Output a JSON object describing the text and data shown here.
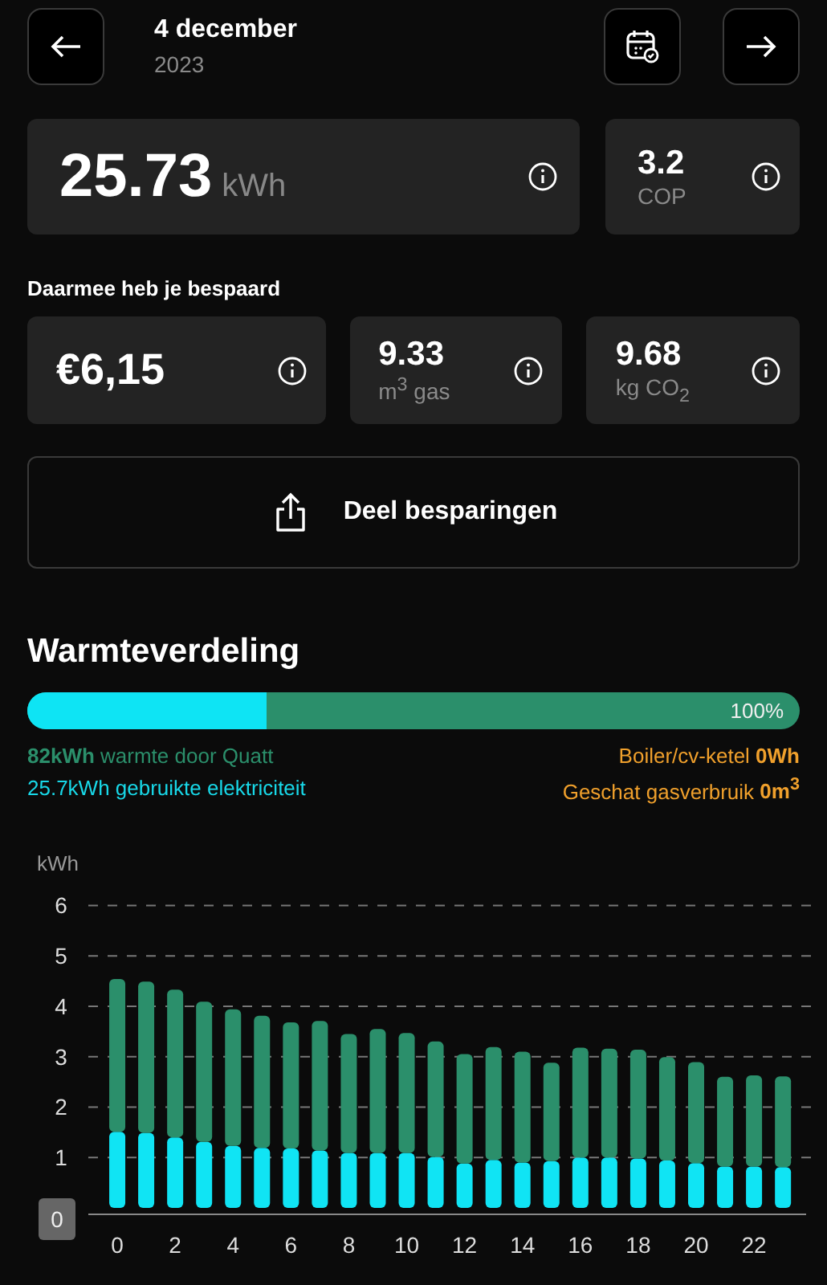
{
  "header": {
    "date": "4 december",
    "year": "2023"
  },
  "energy": {
    "value": "25.73",
    "unit": "kWh"
  },
  "cop": {
    "value": "3.2",
    "label": "COP"
  },
  "savings": {
    "title": "Daarmee heb je bespaard",
    "items": [
      {
        "value": "€6,15"
      },
      {
        "value": "9.33",
        "unit": "m$^{3}$ gas"
      },
      {
        "value": "9.68",
        "unit": "kg CO$_{2}$"
      }
    ]
  },
  "share_button": "Deel besparingen",
  "heat": {
    "title": "Warmteverdeling",
    "level": 0.31,
    "percent": "100%",
    "legend": [
      {
        "text": "**82kWh** warmte door Quatt",
        "color": "#2b8f6b"
      },
      {
        "text": "Boiler/cv-ketel **0Wh**",
        "color": "#f0a02c"
      },
      {
        "text": "25.7kWh gebruikte elektriciteit",
        "color": "#18d8e8"
      },
      {
        "text": "Geschat gasverbruik **0m$^{3}$**",
        "color": "#f0a02c"
      }
    ]
  },
  "chart_data": {
    "type": "bar",
    "ylabel": "kWh",
    "stacked": true,
    "ylim": [
      0,
      6
    ],
    "yticks": [
      0,
      1,
      2,
      3,
      4,
      5,
      6
    ],
    "xticks": [
      0,
      2,
      4,
      6,
      8,
      10,
      12,
      14,
      16,
      18,
      20,
      22
    ],
    "grid": true,
    "xlim": [
      -1,
      23.8
    ],
    "x": [
      0,
      1,
      2,
      3,
      4,
      5,
      6,
      7,
      8,
      9,
      10,
      11,
      12,
      13,
      14,
      15,
      16,
      17,
      18,
      19,
      20,
      21,
      22,
      23
    ],
    "series": [
      {
        "color": "#10e4f4",
        "values": [
          1.51,
          1.49,
          1.4,
          1.31,
          1.23,
          1.19,
          1.18,
          1.14,
          1.09,
          1.09,
          1.09,
          1.01,
          0.88,
          0.95,
          0.9,
          0.93,
          1.0,
          1.0,
          0.98,
          0.94,
          0.89,
          0.82,
          0.82,
          0.81
        ]
      },
      {
        "color": "#2b8f6b",
        "values": [
          3.03,
          3.0,
          2.93,
          2.78,
          2.71,
          2.62,
          2.5,
          2.57,
          2.36,
          2.46,
          2.38,
          2.29,
          2.17,
          2.24,
          2.2,
          1.95,
          2.18,
          2.16,
          2.16,
          2.05,
          2.0,
          1.78,
          1.81,
          1.8
        ]
      }
    ]
  }
}
